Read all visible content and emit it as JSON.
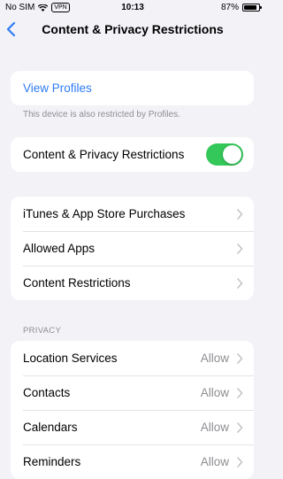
{
  "status_bar": {
    "carrier": "No SIM",
    "vpn": "VPN",
    "time": "10:13",
    "battery": "87%",
    "battery_level": 0.87
  },
  "nav": {
    "title": "Content & Privacy Restrictions",
    "back_icon": "chevron-left-icon"
  },
  "profiles": {
    "label": "View Profiles",
    "footer": "This device is also restricted by Profiles."
  },
  "restrictions_toggle": {
    "label": "Content & Privacy Restrictions",
    "enabled": true
  },
  "store_group": {
    "items": [
      {
        "label": "iTunes & App Store Purchases"
      },
      {
        "label": "Allowed Apps"
      },
      {
        "label": "Content Restrictions"
      }
    ]
  },
  "privacy": {
    "header": "PRIVACY",
    "items": [
      {
        "label": "Location Services",
        "value": "Allow"
      },
      {
        "label": "Contacts",
        "value": "Allow"
      },
      {
        "label": "Calendars",
        "value": "Allow"
      },
      {
        "label": "Reminders",
        "value": "Allow"
      }
    ]
  },
  "colors": {
    "accent": "#2f7cf6",
    "toggle_on": "#34c759",
    "background": "#f2f2f7",
    "secondary_text": "#8e8e93"
  }
}
